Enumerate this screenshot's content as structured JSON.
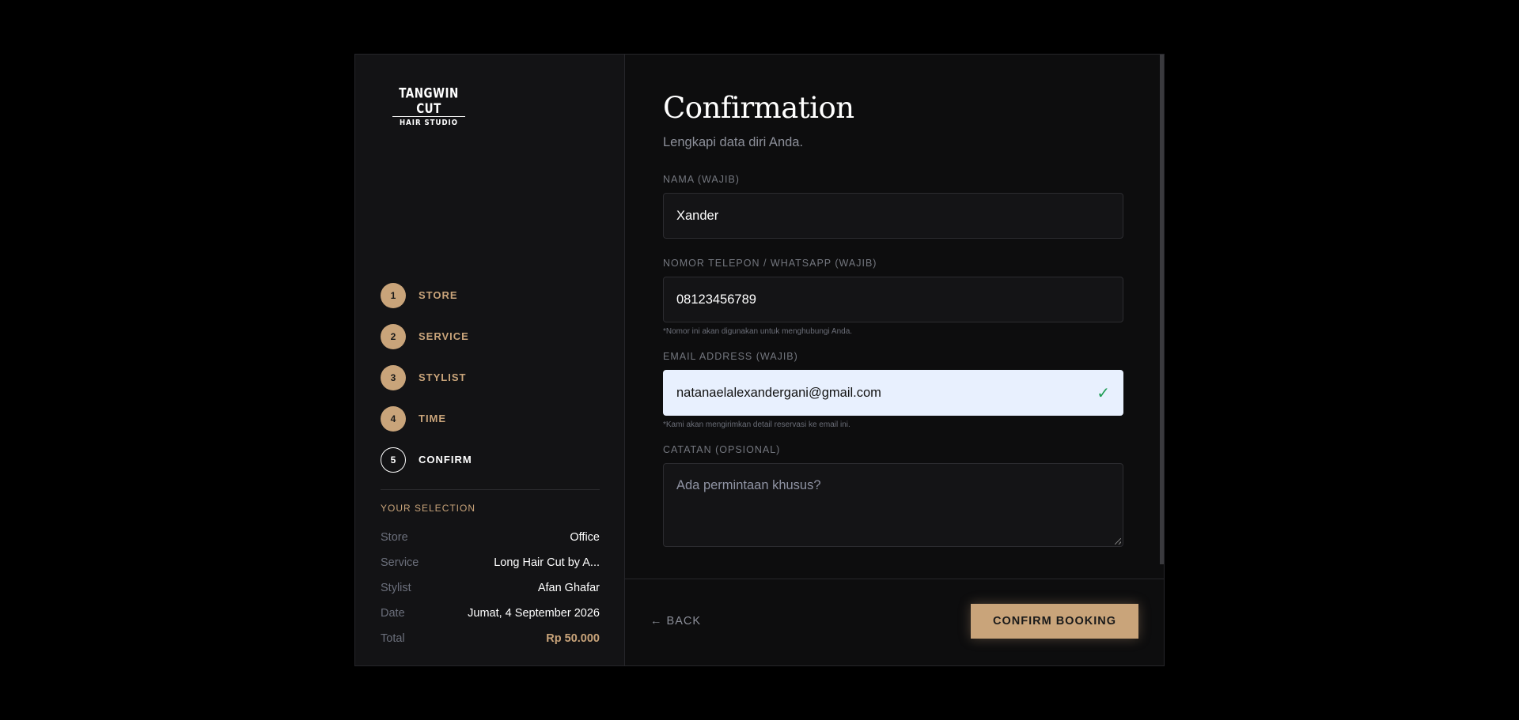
{
  "logo": {
    "line1": "TANGWIN CUT",
    "line2": "HAIR STUDIO"
  },
  "steps": [
    {
      "number": "1",
      "label": "STORE",
      "state": "done"
    },
    {
      "number": "2",
      "label": "SERVICE",
      "state": "done"
    },
    {
      "number": "3",
      "label": "STYLIST",
      "state": "done"
    },
    {
      "number": "4",
      "label": "TIME",
      "state": "done"
    },
    {
      "number": "5",
      "label": "CONFIRM",
      "state": "current"
    }
  ],
  "selection": {
    "title": "YOUR SELECTION",
    "rows": [
      {
        "key": "Store",
        "value": "Office"
      },
      {
        "key": "Service",
        "value": "Long Hair Cut by A..."
      },
      {
        "key": "Stylist",
        "value": "Afan Ghafar"
      },
      {
        "key": "Date",
        "value": "Jumat, 4 September 2026"
      },
      {
        "key": "Total",
        "value": "Rp 50.000"
      }
    ]
  },
  "form": {
    "title": "Confirmation",
    "subtitle": "Lengkapi data diri Anda.",
    "name": {
      "label": "NAMA (WAJIB)",
      "value": "Xander"
    },
    "phone": {
      "label": "NOMOR TELEPON / WHATSAPP (WAJIB)",
      "value": "08123456789",
      "hint": "*Nomor ini akan digunakan untuk menghubungi Anda."
    },
    "email": {
      "label": "EMAIL ADDRESS (WAJIB)",
      "value": "natanaelalexandergani@gmail.com",
      "hint": "*Kami akan mengirimkan detail reservasi ke email ini."
    },
    "notes": {
      "label": "CATATAN (OPSIONAL)",
      "placeholder": "Ada permintaan khusus?"
    }
  },
  "footer": {
    "back_label": "← BACK",
    "confirm_label": "CONFIRM BOOKING"
  },
  "colors": {
    "accent": "#c9a47a",
    "background": "#000000",
    "sidebar": "#131315",
    "panel": "#0d0d0e",
    "autofill": "#e8f0fe",
    "success": "#1f9d55"
  }
}
